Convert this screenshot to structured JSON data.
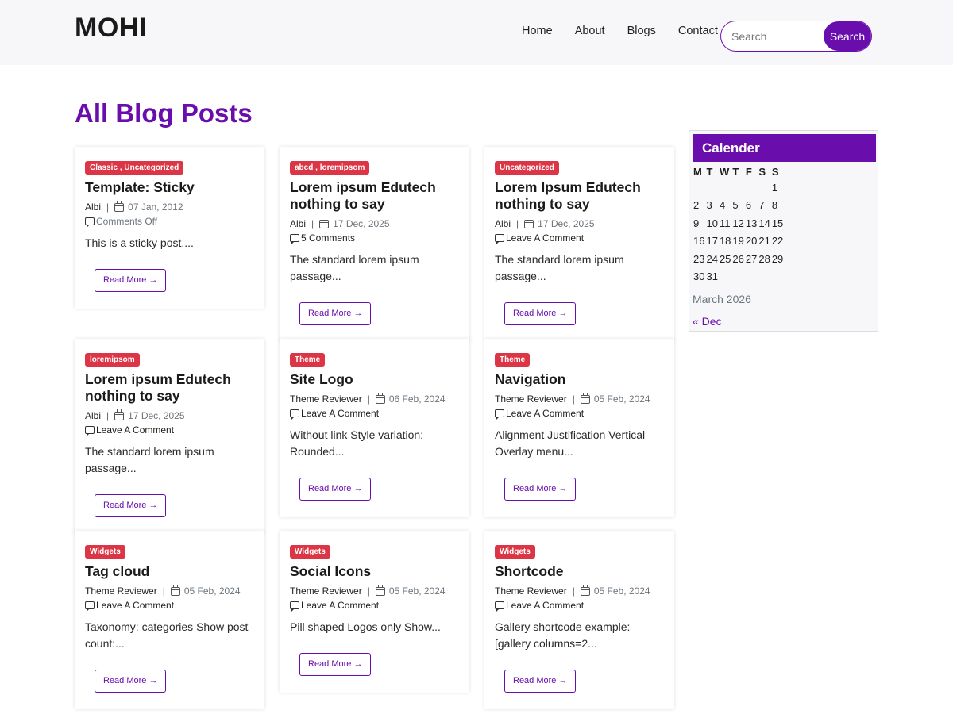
{
  "header": {
    "logo": "MOHI",
    "nav": [
      "Home",
      "About",
      "Blogs",
      "Contact"
    ],
    "search_placeholder": "Search",
    "search_button": "Search"
  },
  "page_title": "All Blog Posts",
  "posts": [
    {
      "cats": [
        "Classic",
        "Uncategorized"
      ],
      "title": "Template: Sticky",
      "author": "Albi",
      "date": "07 Jan, 2012",
      "comments": "Comments Off",
      "excerpt": "This is a sticky post....",
      "read_more": "Read More →"
    },
    {
      "cats": [
        "abcd",
        "loremipsom"
      ],
      "title": "Lorem ipsum Edutech nothing to say",
      "author": "Albi",
      "date": "17 Dec, 2025",
      "comments": "5 Comments",
      "excerpt": "The standard lorem ipsum passage...",
      "read_more": "Read More →"
    },
    {
      "cats": [
        "Uncategorized"
      ],
      "title": "Lorem Ipsum Edutech nothing to say",
      "author": "Albi",
      "date": "17 Dec, 2025",
      "comments": "Leave A Comment",
      "excerpt": "The standard lorem ipsum passage...",
      "read_more": "Read More →"
    },
    {
      "cats": [
        "loremipsom"
      ],
      "title": "Lorem ipsum Edutech nothing to say",
      "author": "Albi",
      "date": "17 Dec, 2025",
      "comments": "Leave A Comment",
      "excerpt": "The standard lorem ipsum passage...",
      "read_more": "Read More →"
    },
    {
      "cats": [
        "Theme"
      ],
      "title": "Site Logo",
      "author": "Theme Reviewer",
      "date": "06 Feb, 2024",
      "comments": "Leave A Comment",
      "excerpt": "Without link Style variation: Rounded...",
      "read_more": "Read More →"
    },
    {
      "cats": [
        "Theme"
      ],
      "title": "Navigation",
      "author": "Theme Reviewer",
      "date": "05 Feb, 2024",
      "comments": "Leave A Comment",
      "excerpt": "Alignment Justification Vertical Overlay menu...",
      "read_more": "Read More →"
    },
    {
      "cats": [
        "Widgets"
      ],
      "title": "Tag cloud",
      "author": "Theme Reviewer",
      "date": "05 Feb, 2024",
      "comments": "Leave A Comment",
      "excerpt": "Taxonomy: categories Show post count:...",
      "read_more": "Read More →"
    },
    {
      "cats": [
        "Widgets"
      ],
      "title": "Social Icons",
      "author": "Theme Reviewer",
      "date": "05 Feb, 2024",
      "comments": "Leave A Comment",
      "excerpt": "Pill shaped Logos only Show...",
      "read_more": "Read More →"
    },
    {
      "cats": [
        "Widgets"
      ],
      "title": "Shortcode",
      "author": "Theme Reviewer",
      "date": "05 Feb, 2024",
      "comments": "Leave A Comment",
      "excerpt": "Gallery shortcode example: [gallery columns=2...",
      "read_more": "Read More →"
    }
  ],
  "calendar": {
    "title": "Calender",
    "weekdays": [
      "M",
      "T",
      "W",
      "T",
      "F",
      "S",
      "S"
    ],
    "weeks": [
      [
        "",
        "",
        "",
        "",
        "",
        "",
        "1"
      ],
      [
        "2",
        "3",
        "4",
        "5",
        "6",
        "7",
        "8"
      ],
      [
        "9",
        "10",
        "11",
        "12",
        "13",
        "14",
        "15"
      ],
      [
        "16",
        "17",
        "18",
        "19",
        "20",
        "21",
        "22"
      ],
      [
        "23",
        "24",
        "25",
        "26",
        "27",
        "28",
        "29"
      ],
      [
        "30",
        "31",
        "",
        "",
        "",
        "",
        ""
      ]
    ],
    "caption": "March 2026",
    "prev_link": "« Dec"
  },
  "colors": {
    "accent": "#6a0dad",
    "category_badge": "#dc3545",
    "header_bg": "#f7f7f9"
  }
}
